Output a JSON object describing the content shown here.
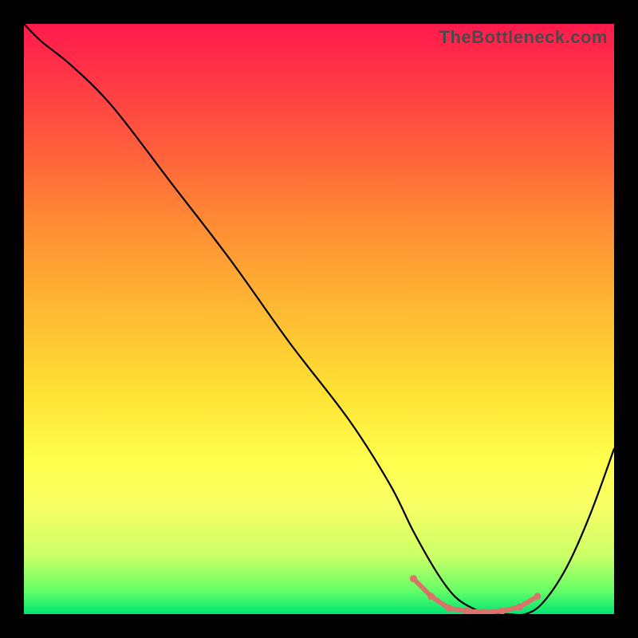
{
  "watermark": "TheBottleneck.com",
  "chart_data": {
    "type": "line",
    "title": "",
    "xlabel": "",
    "ylabel": "",
    "xlim": [
      0,
      100
    ],
    "ylim": [
      0,
      100
    ],
    "series": [
      {
        "name": "bottleneck-curve",
        "x": [
          0,
          3,
          8,
          15,
          25,
          35,
          45,
          55,
          62,
          66,
          70,
          73,
          76,
          79,
          82,
          85,
          88,
          92,
          96,
          100
        ],
        "values": [
          100,
          97,
          93,
          86,
          73,
          60,
          46,
          33,
          22,
          14,
          7,
          3,
          1,
          0,
          0,
          0,
          2,
          8,
          17,
          28
        ]
      }
    ],
    "highlight_segment": {
      "color": "#d9736b",
      "x": [
        66,
        69,
        72,
        75,
        78,
        81,
        84,
        87
      ],
      "values": [
        6,
        3,
        1,
        0.5,
        0.3,
        0.5,
        1.2,
        3
      ]
    }
  }
}
